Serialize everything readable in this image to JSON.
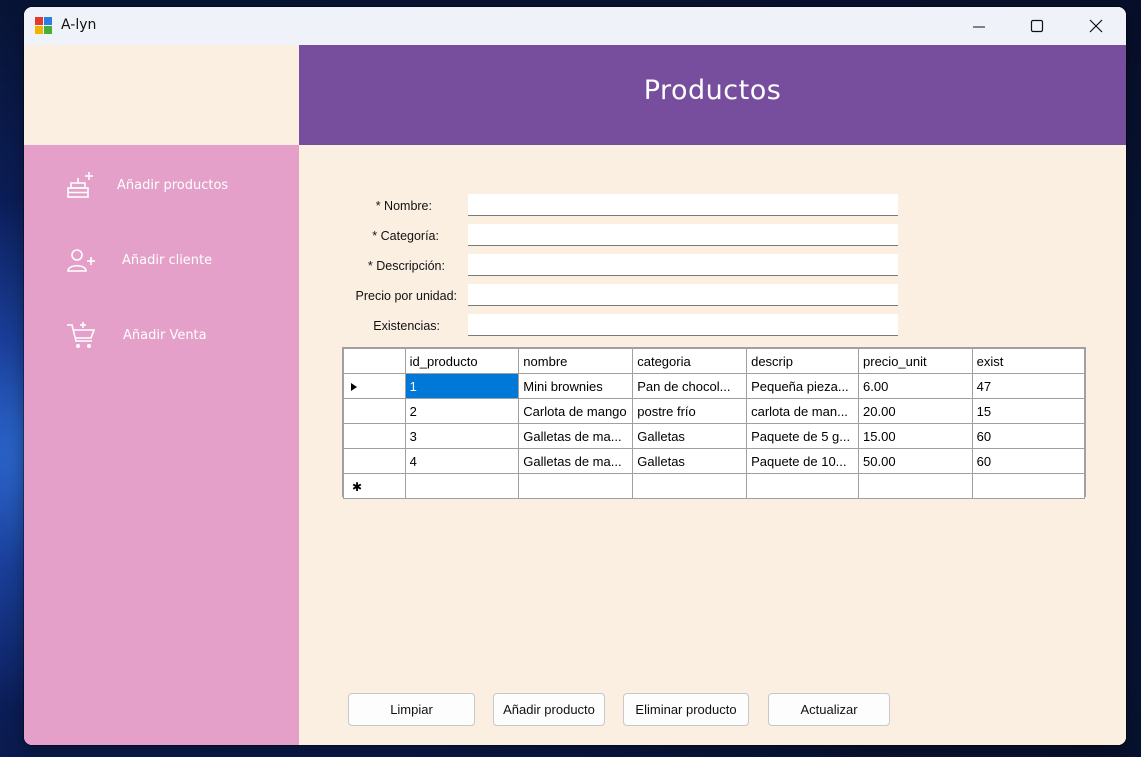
{
  "window": {
    "title": "A-lyn"
  },
  "header": {
    "title": "Productos"
  },
  "sidebar": {
    "items": [
      {
        "label": "Añadir productos",
        "icon": "add-cake-icon"
      },
      {
        "label": "Añadir cliente",
        "icon": "add-user-icon"
      },
      {
        "label": "Añadir Venta",
        "icon": "add-cart-icon"
      }
    ]
  },
  "form": {
    "fields": [
      {
        "label": "* Nombre:",
        "value": ""
      },
      {
        "label": "* Categoría:",
        "value": ""
      },
      {
        "label": "* Descripción:",
        "value": ""
      },
      {
        "label": "Precio por unidad:",
        "value": ""
      },
      {
        "label": "Existencias:",
        "value": ""
      }
    ]
  },
  "table": {
    "columns": [
      "id_producto",
      "nombre",
      "categoria",
      "descrip",
      "precio_unit",
      "exist"
    ],
    "rows": [
      [
        "1",
        "Mini brownies",
        "Pan de chocol...",
        "Pequeña pieza...",
        "6.00",
        "47"
      ],
      [
        "2",
        "Carlota de mango",
        "postre frío",
        "carlota de man...",
        "20.00",
        "15"
      ],
      [
        "3",
        "Galletas de ma...",
        "Galletas",
        "Paquete de 5 g...",
        "15.00",
        "60"
      ],
      [
        "4",
        "Galletas de ma...",
        "Galletas",
        "Paquete de 10...",
        "50.00",
        "60"
      ]
    ]
  },
  "buttons": {
    "clear": "Limpiar",
    "add": "Añadir producto",
    "delete": "Eliminar producto",
    "update": "Actualizar"
  },
  "colors": {
    "header": "#774d9e",
    "sidebar": "#e4a0c9",
    "background": "#fbefe2",
    "selection": "#0078d7"
  }
}
